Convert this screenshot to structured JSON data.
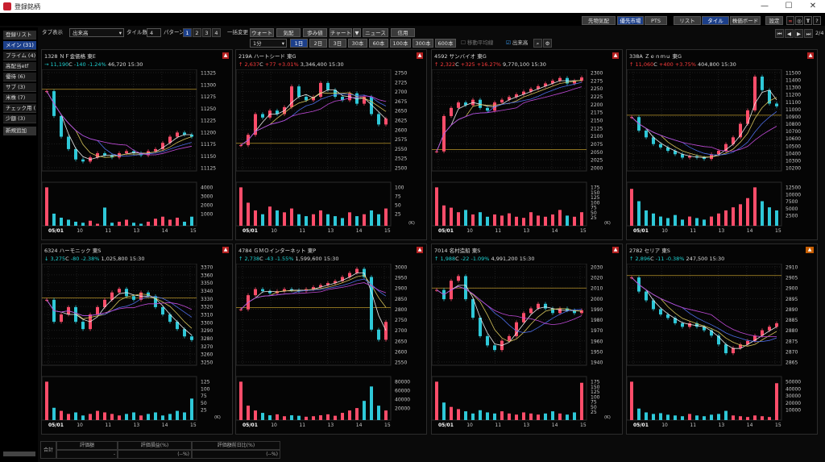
{
  "window": {
    "title": "登録銘柄",
    "controls": [
      "—",
      "☐",
      "✕"
    ]
  },
  "toprow": {
    "buttons": [
      "先物気配",
      "優先市場",
      "PTS",
      "リスト",
      "タイル",
      "株価ボード",
      "設定"
    ],
    "active": [
      "優先市場",
      "タイル"
    ],
    "page": "2/4",
    "nav": [
      "⏮",
      "◀",
      "▶",
      "⏭"
    ]
  },
  "sidebar": {
    "header": "登録リスト",
    "items": [
      "メイン (31)",
      "プライム (4)",
      "高配当etf",
      "優待 (6)",
      "サブ (3)",
      "米株 (7)",
      "チェック用 (",
      "少額 (3)",
      "新規追加"
    ],
    "active": "メイン (31)"
  },
  "controls": {
    "tab_label": "タブ表示",
    "tab_value": "出来高",
    "tile_label": "タイル数",
    "tile_value": "4",
    "pattern_label": "パターン",
    "patterns": [
      "1",
      "2",
      "3",
      "4"
    ],
    "bulk": "一括変更",
    "views": [
      "ウォート",
      "気配",
      "歩み値",
      "チャート",
      "▼",
      "ニュース",
      "信用"
    ],
    "interval": "1分",
    "periods": [
      "1日",
      "2日",
      "3日",
      "30本",
      "60本",
      "100本",
      "300本",
      "600本"
    ],
    "active_period": "1日",
    "chk_ma": "移動平均線",
    "chk_volume": "出来高"
  },
  "icons": {
    "zoom": "magnify-icon",
    "settings": "gear-icon"
  },
  "tiles": [
    {
      "code": "1328",
      "name": "ＮＦ金価格",
      "market": "東E",
      "arrow": "→",
      "price": "11,190",
      "pmark": "C",
      "change": "-140",
      "pct": "-1.24%",
      "volume": "46,720",
      "time": "15:30",
      "dir": "down",
      "yticks": [
        "11325",
        "11300",
        "11275",
        "11250",
        "11225",
        "11200",
        "11175",
        "11150",
        "11125"
      ],
      "vticks": [
        "4000",
        "3000",
        "2000",
        "1000"
      ],
      "xticks": [
        "05/01",
        "10",
        "11",
        "13",
        "14",
        "15"
      ],
      "vunit": "",
      "chart_data": {
        "type": "line",
        "x": [
          0,
          1,
          2,
          3,
          4,
          5,
          6,
          7,
          8,
          9,
          10,
          11,
          12,
          13,
          14,
          15,
          16,
          17,
          18,
          19,
          20
        ],
        "values": [
          11300,
          11240,
          11190,
          11160,
          11135,
          11130,
          11140,
          11150,
          11145,
          11140,
          11150,
          11155,
          11150,
          11145,
          11155,
          11160,
          11175,
          11190,
          11200,
          11195,
          11190
        ],
        "ylim": [
          11115,
          11345
        ],
        "vol": [
          3800,
          1200,
          800,
          600,
          400,
          300,
          500,
          200,
          1800,
          300,
          400,
          600,
          300,
          200,
          400,
          700,
          900,
          600,
          800,
          400,
          900
        ]
      }
    },
    {
      "code": "219A",
      "name": "ハートシード",
      "market": "東G",
      "arrow": "↑",
      "price": "2,637",
      "pmark": "C",
      "change": "+77",
      "pct": "+3.01%",
      "volume": "3,346,400",
      "time": "15:30",
      "dir": "up",
      "yticks": [
        "2750",
        "2725",
        "2700",
        "2675",
        "2650",
        "2625",
        "2600",
        "2575",
        "2550",
        "2525",
        "2500"
      ],
      "vticks": [
        "100",
        "75",
        "50",
        "25"
      ],
      "xticks": [
        "05/01",
        "10",
        "11",
        "13",
        "14",
        "15"
      ],
      "vunit": "(K)",
      "chart_data": {
        "type": "line",
        "x": [
          0,
          1,
          2,
          3,
          4,
          5,
          6,
          7,
          8,
          9,
          10,
          11,
          12,
          13,
          14,
          15,
          16,
          17,
          18,
          19,
          20
        ],
        "values": [
          2560,
          2590,
          2650,
          2640,
          2660,
          2650,
          2670,
          2730,
          2700,
          2690,
          2700,
          2740,
          2720,
          2700,
          2690,
          2710,
          2680,
          2700,
          2650,
          2620,
          2637
        ],
        "ylim": [
          2495,
          2770
        ],
        "vol": [
          100,
          60,
          40,
          30,
          50,
          40,
          35,
          45,
          30,
          25,
          30,
          40,
          30,
          25,
          20,
          35,
          25,
          30,
          40,
          30,
          45
        ]
      }
    },
    {
      "code": "4592",
      "name": "サンバイオ",
      "market": "東G",
      "arrow": "↑",
      "price": "2,322",
      "pmark": "C",
      "change": "+325",
      "pct": "+16.27%",
      "volume": "9,770,100",
      "time": "15:30",
      "dir": "up",
      "yticks": [
        "2300",
        "2275",
        "2250",
        "2225",
        "2200",
        "2175",
        "2150",
        "2125",
        "2100",
        "2075",
        "2050",
        "2025",
        "2000"
      ],
      "vticks": [
        "175",
        "150",
        "125",
        "100",
        "75",
        "50",
        "25"
      ],
      "xticks": [
        "05/01",
        "10",
        "11",
        "13",
        "14",
        "15"
      ],
      "vunit": "(K)",
      "chart_data": {
        "type": "line",
        "x": [
          0,
          1,
          2,
          3,
          4,
          5,
          6,
          7,
          8,
          9,
          10,
          11,
          12,
          13,
          14,
          15,
          16,
          17,
          18,
          19,
          20
        ],
        "values": [
          2050,
          2180,
          2210,
          2230,
          2220,
          2240,
          2210,
          2200,
          2230,
          2240,
          2250,
          2260,
          2270,
          2280,
          2290,
          2300,
          2310,
          2320,
          2300,
          2310,
          2322
        ],
        "ylim": [
          1990,
          2340
        ],
        "vol": [
          170,
          90,
          80,
          60,
          70,
          50,
          60,
          40,
          50,
          45,
          55,
          40,
          35,
          60,
          45,
          40,
          50,
          70,
          45,
          40,
          60
        ]
      }
    },
    {
      "code": "338A",
      "name": "Ｚｅｎｍｕ",
      "market": "東G",
      "arrow": "↑",
      "price": "11,060",
      "pmark": "C",
      "change": "+400",
      "pct": "+3.75%",
      "volume": "404,800",
      "time": "15:30",
      "dir": "up",
      "yticks": [
        "11500",
        "11400",
        "11300",
        "11200",
        "11100",
        "11000",
        "10900",
        "10800",
        "10700",
        "10600",
        "10500",
        "10400",
        "10300",
        "10200"
      ],
      "vticks": [
        "12500",
        "10000",
        "7500",
        "5000",
        "2500"
      ],
      "xticks": [
        "05/01",
        "10",
        "11",
        "13",
        "14",
        "15"
      ],
      "vunit": "",
      "chart_data": {
        "type": "line",
        "x": [
          0,
          1,
          2,
          3,
          4,
          5,
          6,
          7,
          8,
          9,
          10,
          11,
          12,
          13,
          14,
          15,
          16,
          17,
          18,
          19,
          20
        ],
        "values": [
          10900,
          10700,
          10600,
          10500,
          10450,
          10400,
          10350,
          10300,
          10320,
          10300,
          10280,
          10350,
          10400,
          10500,
          10600,
          10800,
          11000,
          11500,
          11300,
          11100,
          11060
        ],
        "ylim": [
          10150,
          11560
        ],
        "vol": [
          12000,
          8000,
          5000,
          4000,
          3000,
          2500,
          3500,
          2000,
          3000,
          2500,
          2000,
          3000,
          4000,
          5000,
          6000,
          7000,
          9000,
          12500,
          8000,
          6000,
          5000
        ]
      }
    },
    {
      "code": "6324",
      "name": "ハーモニック",
      "market": "東S",
      "arrow": "↓",
      "price": "3,275",
      "pmark": "C",
      "change": "-80",
      "pct": "-2.38%",
      "volume": "1,025,800",
      "time": "15:30",
      "dir": "down",
      "yticks": [
        "3370",
        "3360",
        "3350",
        "3340",
        "3330",
        "3320",
        "3310",
        "3300",
        "3290",
        "3280",
        "3270",
        "3260",
        "3250"
      ],
      "vticks": [
        "125",
        "100",
        "75",
        "50",
        "25"
      ],
      "xticks": [
        "05/01",
        "10",
        "11",
        "13",
        "14",
        "15"
      ],
      "vunit": "(K)",
      "chart_data": {
        "type": "line",
        "x": [
          0,
          1,
          2,
          3,
          4,
          5,
          6,
          7,
          8,
          9,
          10,
          11,
          12,
          13,
          14,
          15,
          16,
          17,
          18,
          19,
          20
        ],
        "values": [
          3330,
          3300,
          3310,
          3320,
          3300,
          3290,
          3310,
          3320,
          3330,
          3340,
          3345,
          3335,
          3330,
          3340,
          3335,
          3320,
          3310,
          3300,
          3290,
          3280,
          3275
        ],
        "ylim": [
          3245,
          3375
        ],
        "vol": [
          125,
          40,
          30,
          20,
          25,
          15,
          20,
          30,
          25,
          20,
          15,
          20,
          25,
          15,
          20,
          25,
          15,
          20,
          30,
          25,
          70
        ]
      }
    },
    {
      "code": "4784",
      "name": "ＧＭＯインターネット",
      "market": "東P",
      "arrow": "↑",
      "price": "2,738",
      "pmark": "C",
      "change": "-43",
      "pct": "-1.55%",
      "volume": "1,599,600",
      "time": "15:30",
      "dir": "down",
      "yticks": [
        "3000",
        "2950",
        "2900",
        "2850",
        "2800",
        "2750",
        "2700",
        "2650",
        "2600",
        "2550"
      ],
      "vticks": [
        "80000",
        "60000",
        "40000",
        "20000"
      ],
      "xticks": [
        "05/01",
        "10",
        "11",
        "13",
        "14",
        "15"
      ],
      "vunit": "",
      "chart_data": {
        "type": "line",
        "x": [
          0,
          1,
          2,
          3,
          4,
          5,
          6,
          7,
          8,
          9,
          10,
          11,
          12,
          13,
          14,
          15,
          16,
          17,
          18,
          19,
          20
        ],
        "values": [
          2800,
          2870,
          2900,
          2890,
          2880,
          2890,
          2900,
          2895,
          2890,
          2900,
          2910,
          2920,
          2930,
          2940,
          2960,
          2980,
          3000,
          2960,
          2700,
          2650,
          2738
        ],
        "ylim": [
          2540,
          3010
        ],
        "vol": [
          80000,
          30000,
          20000,
          15000,
          10000,
          12000,
          8000,
          10000,
          9000,
          7000,
          8000,
          10000,
          12000,
          9000,
          15000,
          20000,
          25000,
          40000,
          70000,
          30000,
          20000
        ]
      }
    },
    {
      "code": "7014",
      "name": "名村造船",
      "market": "東S",
      "arrow": "↑",
      "price": "1,988",
      "pmark": "C",
      "change": "-22",
      "pct": "-1.09%",
      "volume": "4,991,200",
      "time": "15:30",
      "dir": "down",
      "yticks": [
        "2030",
        "2020",
        "2010",
        "2000",
        "1990",
        "1980",
        "1970",
        "1960",
        "1950",
        "1940"
      ],
      "vticks": [
        "175",
        "150",
        "125",
        "100",
        "75",
        "50",
        "25"
      ],
      "xticks": [
        "05/01",
        "10",
        "11",
        "13",
        "14",
        "15"
      ],
      "vunit": "(K)",
      "chart_data": {
        "type": "line",
        "x": [
          0,
          1,
          2,
          3,
          4,
          5,
          6,
          7,
          8,
          9,
          10,
          11,
          12,
          13,
          14,
          15,
          16,
          17,
          18,
          19,
          20
        ],
        "values": [
          2010,
          2000,
          2020,
          2025,
          2000,
          1980,
          1960,
          1950,
          1945,
          1955,
          1960,
          1975,
          1985,
          1990,
          1995,
          1990,
          1985,
          1990,
          1988,
          1985,
          1988
        ],
        "ylim": [
          1932,
          2035
        ],
        "vol": [
          175,
          80,
          60,
          50,
          40,
          30,
          45,
          35,
          30,
          40,
          30,
          25,
          35,
          30,
          25,
          30,
          40,
          30,
          25,
          35,
          170
        ]
      }
    },
    {
      "code": "2782",
      "name": "セリア",
      "market": "東S",
      "arrow": "↑",
      "price": "2,896",
      "pmark": "C",
      "change": "-11",
      "pct": "-0.38%",
      "volume": "247,500",
      "time": "15:30",
      "dir": "down",
      "yticks": [
        "2910",
        "2905",
        "2900",
        "2895",
        "2890",
        "2885",
        "2880",
        "2875",
        "2870",
        "2865"
      ],
      "vticks": [
        "50000",
        "40000",
        "30000",
        "20000",
        "10000"
      ],
      "xticks": [
        "05/01",
        "10",
        "11",
        "13",
        "14",
        "15"
      ],
      "vunit": "",
      "chart_data": {
        "type": "line",
        "x": [
          0,
          1,
          2,
          3,
          4,
          5,
          6,
          7,
          8,
          9,
          10,
          11,
          12,
          13,
          14,
          15,
          16,
          17,
          18,
          19,
          20
        ],
        "values": [
          2908,
          2900,
          2895,
          2890,
          2887,
          2885,
          2882,
          2880,
          2882,
          2880,
          2878,
          2875,
          2870,
          2865,
          2868,
          2870,
          2872,
          2875,
          2878,
          2880,
          2882
        ],
        "ylim": [
          2860,
          2914
        ],
        "vol": [
          50000,
          15000,
          10000,
          8000,
          9000,
          7000,
          6000,
          5000,
          8000,
          6000,
          5000,
          7000,
          8000,
          12000,
          6000,
          5000,
          4000,
          6000,
          5000,
          4000,
          48000
        ]
      }
    }
  ],
  "footer": {
    "total": "合計",
    "h1": "評価額",
    "h2": "評価損益(%)",
    "h3": "評価額前日比(%)",
    "v1": "-",
    "v2": "(--%)",
    "v3": "(--%)"
  },
  "colors": {
    "up": "#ff3c3c",
    "down": "#1fd3d3",
    "candle_up": "#ff4d6a",
    "candle_down": "#2ec8d8",
    "ma1": "#e8e8e8",
    "ma2": "#d4c25a",
    "ma3": "#4d6de8",
    "ma4": "#c04ad8",
    "grid": "#1e1e1e",
    "text": "#cccccc",
    "hline": "#b8952a"
  }
}
